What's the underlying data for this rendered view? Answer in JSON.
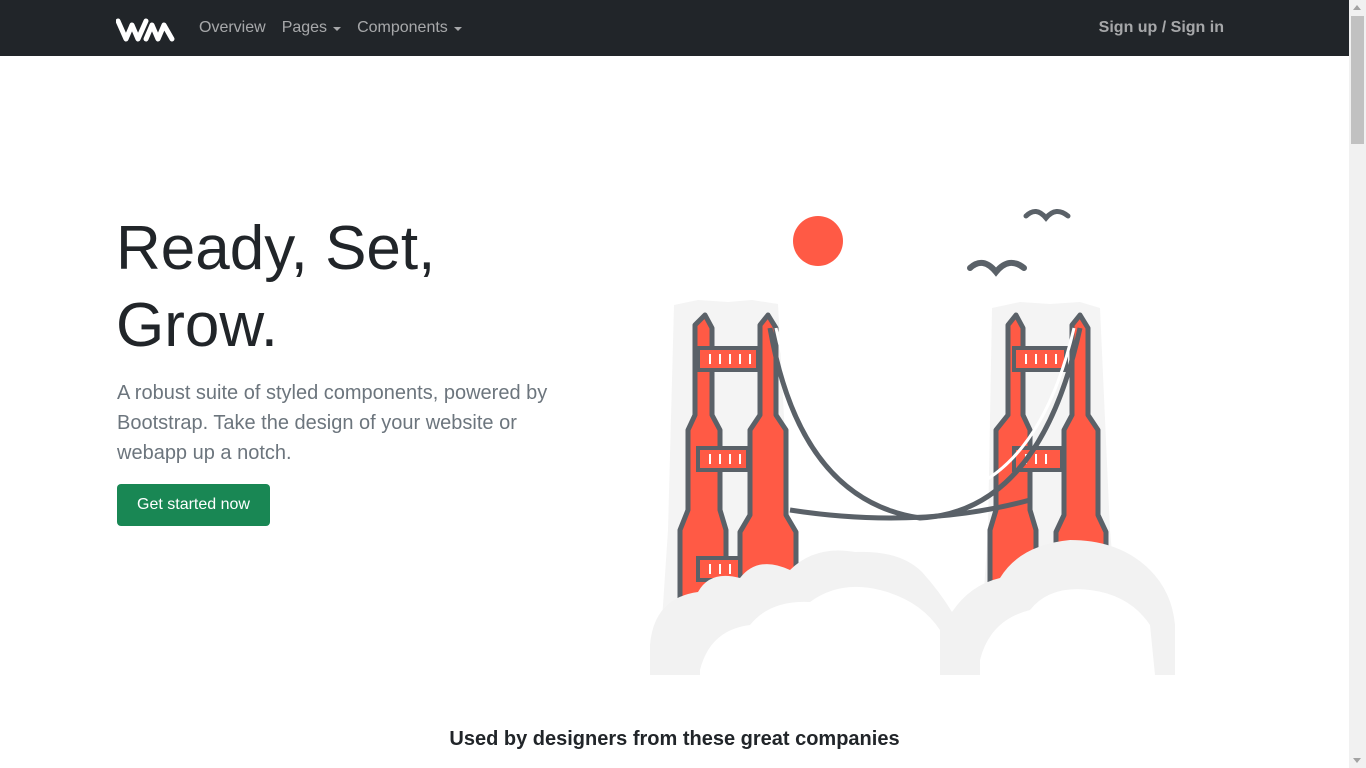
{
  "navbar": {
    "brand_icon": "wm-logo",
    "links": [
      {
        "label": "Overview",
        "dropdown": false
      },
      {
        "label": "Pages",
        "dropdown": true
      },
      {
        "label": "Components",
        "dropdown": true
      }
    ],
    "auth_label": "Sign up / Sign in"
  },
  "hero": {
    "title_line1": "Ready, Set,",
    "title_line2": "Grow.",
    "description": "A robust suite of styled components, powered by Bootstrap. Take the design of your website or webapp up a notch.",
    "cta_label": "Get started now",
    "illustration_icon": "golden-gate-bridge-illustration"
  },
  "companies": {
    "heading": "Used by designers from these great companies"
  },
  "colors": {
    "navbar_bg": "#212529",
    "primary_button": "#198754",
    "accent": "#ff5a45",
    "bridge_outline": "#5a6168",
    "cloud": "#f2f2f2"
  }
}
